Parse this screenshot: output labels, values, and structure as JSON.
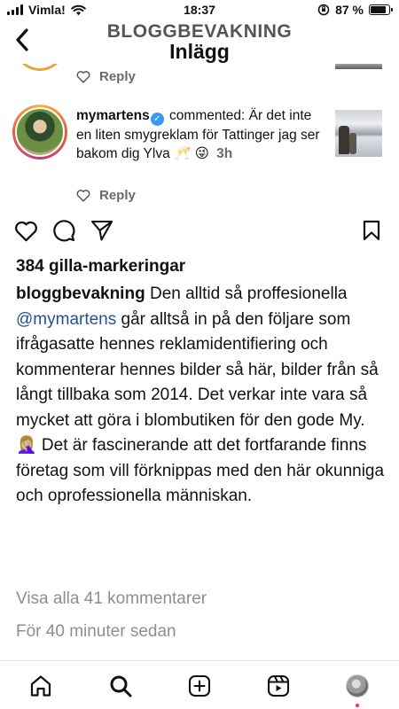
{
  "status_bar": {
    "carrier": "Vimla!",
    "time": "18:37",
    "battery_percent": "87 %",
    "battery_level": 0.87
  },
  "header": {
    "account": "BLOGGBEVAKNING",
    "title": "Inlägg"
  },
  "previous_comment": {
    "reply_label": "Reply"
  },
  "comment": {
    "username": "mymartens",
    "text": "commented: Är det inte en liten smygreklam för Tattinger jag ser bakom dig Ylva 🥂 😜",
    "time": "3h",
    "reply_label": "Reply"
  },
  "post": {
    "likes": "384 gilla-markeringar",
    "caption_user": "bloggbevakning",
    "caption_part1": "Den alltid så proffesionella",
    "caption_mention": "@mymartens",
    "caption_part2": "går alltså in på den följare som ifrågasatte hennes reklamidentifiering och kommenterar hennes bilder så här, bilder från så långt tillbaka som 2014. Det verkar inte vara så mycket att göra i blombutiken för den gode My. 🤦🏼‍♀️ Det är fascinerande att det fortfarande finns företag som vill förknippas med den här okunniga och oprofessionella människan.",
    "view_all_comments": "Visa alla 41 kommentarer",
    "time_ago": "För 40 minuter sedan"
  },
  "icons": {
    "back": "chevron-left-icon",
    "like": "heart-icon",
    "comment": "comment-bubble-icon",
    "share": "paper-plane-icon",
    "save": "bookmark-icon",
    "home": "home-icon",
    "search": "search-icon",
    "create": "plus-square-icon",
    "reels": "reels-icon",
    "profile": "profile-avatar"
  }
}
